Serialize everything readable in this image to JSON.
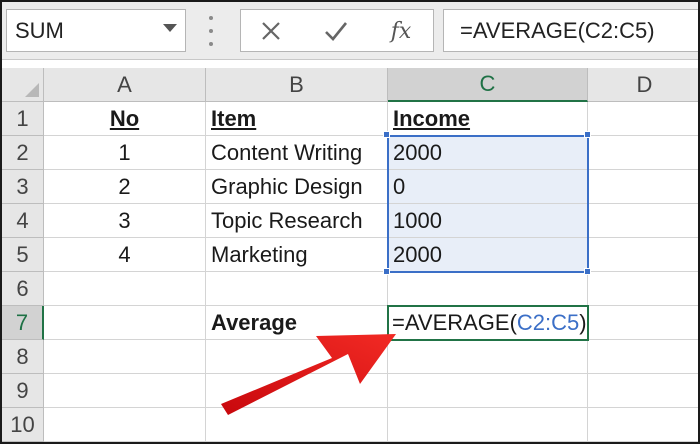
{
  "formula_bar": {
    "name_box": "SUM",
    "cancel_icon": "close-icon",
    "enter_icon": "checkmark-icon",
    "function_label": "fx",
    "formula": "=AVERAGE(C2:C5)"
  },
  "columns": [
    "A",
    "B",
    "C",
    "D"
  ],
  "selected_column": "C",
  "rows": [
    "1",
    "2",
    "3",
    "4",
    "5",
    "6",
    "7",
    "8",
    "9",
    "10"
  ],
  "selected_row": "7",
  "headers": {
    "no": "No",
    "item": "Item",
    "income": "Income"
  },
  "data_rows": [
    {
      "no": "1",
      "item": "Content Writing",
      "income": "2000"
    },
    {
      "no": "2",
      "item": "Graphic Design",
      "income": "0"
    },
    {
      "no": "3",
      "item": "Topic Research",
      "income": "1000"
    },
    {
      "no": "4",
      "item": "Marketing",
      "income": "2000"
    }
  ],
  "average_label": "Average",
  "active_cell": {
    "prefix": "=AVERAGE(",
    "reference": "C2:C5",
    "suffix": ")"
  },
  "colors": {
    "range_highlight": "#3b6fc7",
    "active_border": "#217346",
    "arrow": "#e0191b"
  }
}
